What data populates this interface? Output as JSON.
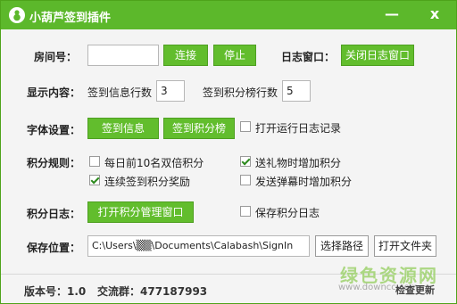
{
  "window": {
    "title": "小葫芦签到插件",
    "minimize": "—",
    "close": "x"
  },
  "room": {
    "label": "房间号：",
    "value": "",
    "connect": "连接",
    "stop": "停止"
  },
  "log_window": {
    "label": "日志窗口：",
    "close_btn": "关闭日志窗口"
  },
  "display": {
    "label": "显示内容：",
    "checkin_rows_label": "签到信息行数",
    "checkin_rows": "3",
    "points_rows_label": "签到积分榜行数",
    "points_rows": "5"
  },
  "font": {
    "label": "字体设置：",
    "btn_checkin": "签到信息",
    "btn_points": "签到积分榜",
    "runlog_label": "打开运行日志记录",
    "runlog_checked": false
  },
  "rules": {
    "label": "积分规则：",
    "items": [
      {
        "label": "每日前10名双倍积分",
        "checked": false
      },
      {
        "label": "送礼物时增加积分",
        "checked": true
      },
      {
        "label": "连续签到积分奖励",
        "checked": true
      },
      {
        "label": "发送弹幕时增加积分",
        "checked": false
      }
    ]
  },
  "points_log": {
    "label": "积分日志：",
    "open_btn": "打开积分管理窗口",
    "save_label": "保存积分日志",
    "save_checked": false
  },
  "save": {
    "label": "保存位置：",
    "path": "C:\\Users\\▒▒\\Documents\\Calabash\\SignIn",
    "choose": "选择路径",
    "open_folder": "打开文件夹"
  },
  "footer": {
    "version": "版本号：1.0",
    "group": "交流群：477187993",
    "update": "检查更新"
  },
  "watermark": {
    "line1": "绿色资源网",
    "line2": "www.downcc.com"
  },
  "colors": {
    "accent": "#5cb82b",
    "button": "#62bd2d"
  }
}
